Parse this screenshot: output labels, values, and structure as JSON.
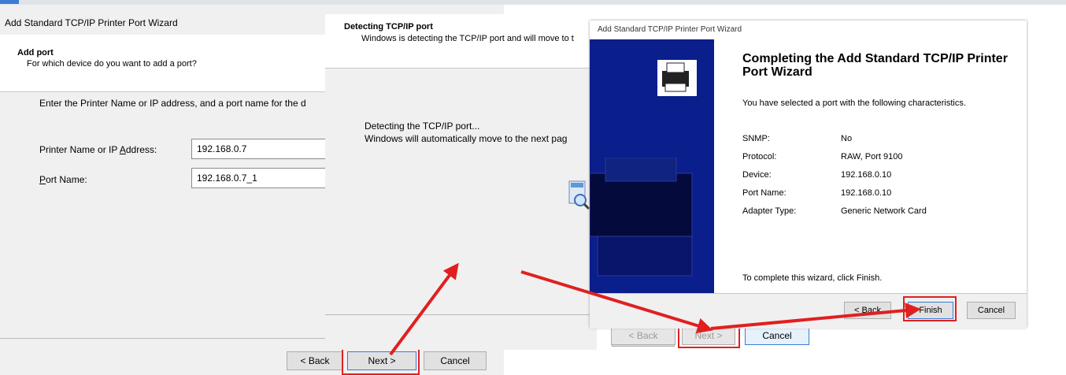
{
  "w1": {
    "title": "Add Standard TCP/IP Printer Port Wizard",
    "header_title": "Add port",
    "header_subtitle": "For which device do you want to add a port?",
    "instruction": "Enter the Printer Name or IP address, and a port name for the d",
    "printer_name_label": "Printer Name or IP Address:",
    "printer_name_value": "192.168.0.7",
    "port_name_label": "Port Name:",
    "port_name_value": "192.168.0.7_1",
    "back_label": "< Back",
    "next_label": "Next >",
    "cancel_label": "Cancel"
  },
  "w2": {
    "header_title": "Detecting TCP/IP port",
    "header_subtitle": "Windows is detecting the TCP/IP port and will move to t",
    "body_line1": "Detecting the TCP/IP port...",
    "body_line2": "Windows will automatically move to the next pag",
    "back_label": "< Back",
    "next_label": "Next >",
    "cancel_label": "Cancel"
  },
  "w3": {
    "title": "Add Standard TCP/IP Printer Port Wizard",
    "heading": "Completing the Add Standard TCP/IP Printer Port Wizard",
    "intro": "You have selected a port with the following characteristics.",
    "rows": [
      {
        "label": "SNMP:",
        "value": "No"
      },
      {
        "label": "Protocol:",
        "value": "RAW, Port 9100"
      },
      {
        "label": "Device:",
        "value": "192.168.0.10"
      },
      {
        "label": "Port Name:",
        "value": "192.168.0.10"
      },
      {
        "label": "Adapter Type:",
        "value": "Generic Network Card"
      }
    ],
    "footer": "To complete this wizard, click Finish.",
    "back_label": "< Back",
    "finish_label": "Finish",
    "cancel_label": "Cancel"
  },
  "colors": {
    "annotation_red": "#e02020",
    "wizard_band": "#0a1e8c",
    "highlight_button": "#3c7bd6"
  },
  "icons": [
    "magnifier-icon",
    "printer-wizard-icon",
    "red-arrow"
  ]
}
